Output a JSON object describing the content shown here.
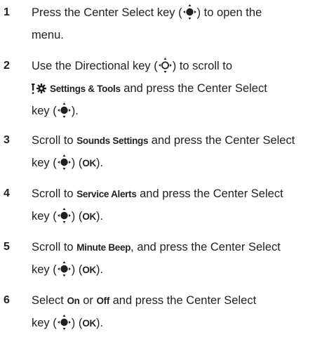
{
  "steps": [
    {
      "number": "1",
      "lines": [
        {
          "a": "Press the Center Select key (",
          "b": ") to open the"
        },
        {
          "a": "menu."
        }
      ]
    },
    {
      "number": "2",
      "lines": [
        {
          "a": "Use the Directional key (",
          "b": ") to scroll to"
        },
        {
          "bold": "Settings & Tools",
          "b": " and press the Center Select"
        },
        {
          "a": "key (",
          "b": ")."
        }
      ]
    },
    {
      "number": "3",
      "lines": [
        {
          "a": "Scroll to ",
          "bold": "Sounds Settings",
          "b": " and press the Center Select"
        },
        {
          "a": "key (",
          "b": ") (",
          "bold2": "OK",
          "c": ")."
        }
      ]
    },
    {
      "number": "4",
      "lines": [
        {
          "a": "Scroll to ",
          "bold": "Service Alerts",
          "b": " and press the Center Select"
        },
        {
          "a": "key (",
          "b": ") (",
          "bold2": "OK",
          "c": ")."
        }
      ]
    },
    {
      "number": "5",
      "lines": [
        {
          "a": "Scroll to ",
          "bold": "Minute Beep",
          "b": ", and press the Center Select"
        },
        {
          "a": "key (",
          "b": ") (",
          "bold2": "OK",
          "c": ")."
        }
      ]
    },
    {
      "number": "6",
      "lines": [
        {
          "a": "Select ",
          "bold": "On",
          "b": " or ",
          "bold2": "Off",
          "c": " and press the Center Select"
        },
        {
          "a": "key (",
          "b": ") (",
          "bold3": "OK",
          "d": ")."
        }
      ]
    }
  ],
  "icons": {
    "center_select": "center-select-key-icon",
    "directional": "directional-key-icon",
    "settings_tools": "settings-tools-icon"
  },
  "colors": {
    "text": "#231f20",
    "background": "#ffffff"
  }
}
